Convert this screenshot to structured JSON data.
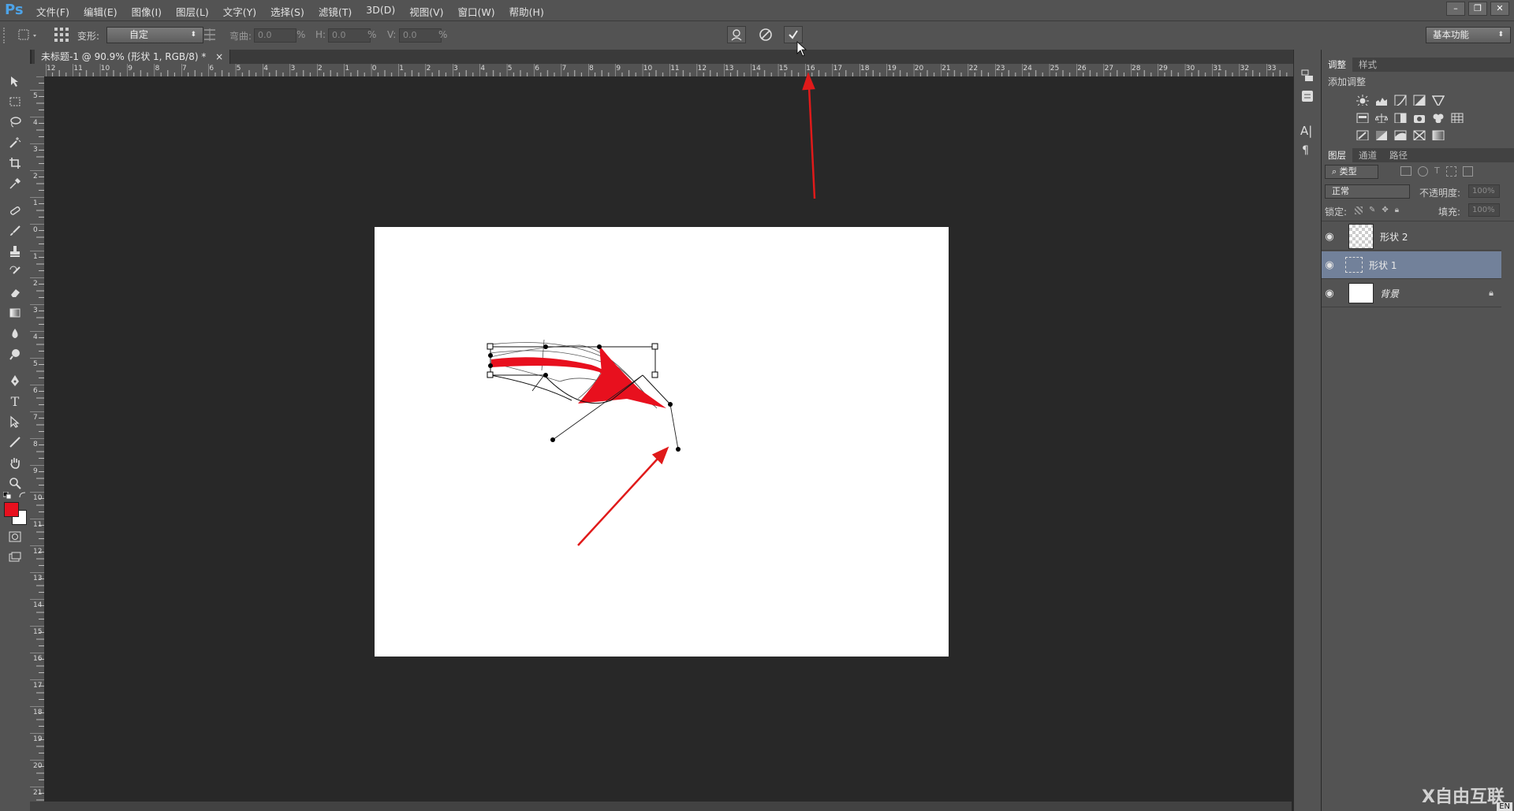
{
  "app": {
    "logo": "Ps"
  },
  "menu": [
    "文件(F)",
    "编辑(E)",
    "图像(I)",
    "图层(L)",
    "文字(Y)",
    "选择(S)",
    "滤镜(T)",
    "3D(D)",
    "视图(V)",
    "窗口(W)",
    "帮助(H)"
  ],
  "options": {
    "warp_label": "变形:",
    "warp_value": "自定",
    "bend_label": "弯曲:",
    "bend_value": "0.0",
    "h_label": "H:",
    "h_value": "0.0",
    "v_label": "V:",
    "v_value": "0.0",
    "pct": "%",
    "workspace": "基本功能"
  },
  "document_tab": {
    "title": "未标题-1 @ 90.9% (形状 1, RGB/8) *",
    "close": "×"
  },
  "ruler_top": [
    "12",
    "11",
    "10",
    "9",
    "8",
    "7",
    "6",
    "5",
    "4",
    "3",
    "2",
    "1",
    "0",
    "1",
    "2",
    "3",
    "4",
    "5",
    "6",
    "7",
    "8",
    "9",
    "10",
    "11",
    "12",
    "13",
    "14",
    "15",
    "16",
    "17",
    "18",
    "19",
    "20",
    "21",
    "22",
    "23",
    "24",
    "25",
    "26",
    "27",
    "28",
    "29",
    "30",
    "31",
    "32",
    "33"
  ],
  "ruler_left": [
    "5",
    "4",
    "3",
    "2",
    "1",
    "0",
    "1",
    "2",
    "3",
    "4",
    "5",
    "6",
    "7",
    "8",
    "9",
    "10",
    "11",
    "12",
    "13",
    "14",
    "15",
    "16",
    "17",
    "18",
    "19",
    "20",
    "21"
  ],
  "adjustments": {
    "tabs": [
      "调整",
      "样式"
    ],
    "title": "添加调整"
  },
  "layers_panel": {
    "tabs": [
      "图层",
      "通道",
      "路径"
    ],
    "filter_kind": "类型",
    "blend_mode": "正常",
    "opacity_label": "不透明度:",
    "opacity_value": "100%",
    "lock_label": "锁定:",
    "fill_label": "填充:",
    "fill_value": "100%",
    "layers": [
      {
        "name": "形状 2",
        "selected": false
      },
      {
        "name": "形状 1",
        "selected": true
      },
      {
        "name": "背景",
        "selected": false
      }
    ]
  },
  "watermark": "X自由互联",
  "ime": "EN",
  "colors": {
    "foreground": "#e8101e",
    "background": "#ffffff",
    "annotation_arrow": "#e01a1a",
    "selected_layer": "#72819a"
  }
}
